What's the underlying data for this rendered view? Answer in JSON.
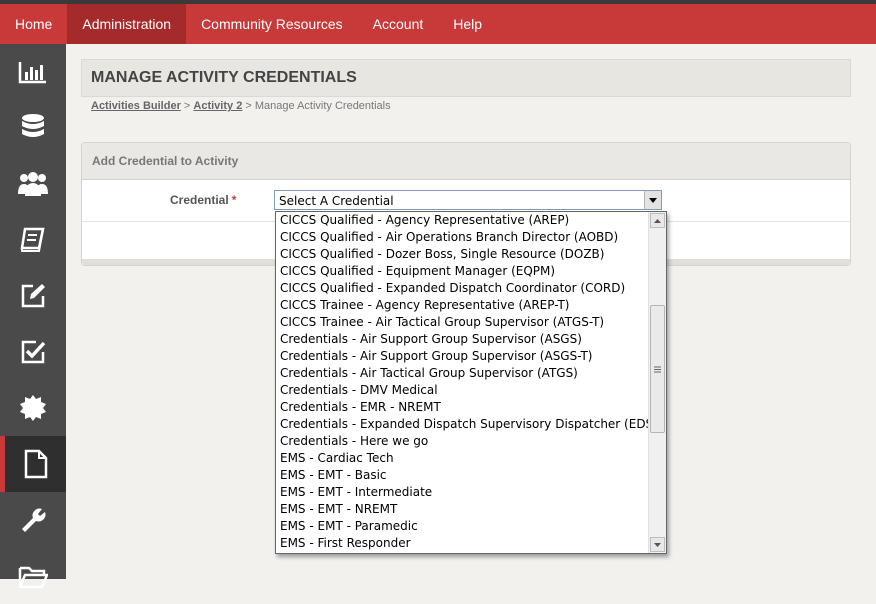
{
  "nav": {
    "items": [
      {
        "label": "Home"
      },
      {
        "label": "Administration"
      },
      {
        "label": "Community Resources"
      },
      {
        "label": "Account"
      },
      {
        "label": "Help"
      }
    ],
    "active": "Administration"
  },
  "sidebar": {
    "icons": [
      "bar-chart-icon",
      "database-icon",
      "users-icon",
      "book-icon",
      "edit-icon",
      "checkbox-icon",
      "certificate-icon",
      "document-icon",
      "wrench-icon",
      "folder-icon"
    ],
    "active": "document-icon"
  },
  "page": {
    "title": "MANAGE ACTIVITY CREDENTIALS"
  },
  "breadcrumb": {
    "link1": "Activities Builder",
    "sep1": " > ",
    "link2": "Activity 2",
    "sep2": " > ",
    "current": "Manage Activity Credentials"
  },
  "panel": {
    "header": "Add Credential to Activity",
    "credential_label": "Credential",
    "required_mark": "*"
  },
  "credential_select": {
    "value": "Select A Credential",
    "options": [
      "CICCS Qualified - Agency Representative (AREP)",
      "CICCS Qualified - Air Operations Branch Director (AOBD)",
      "CICCS Qualified - Dozer Boss, Single Resource (DOZB)",
      "CICCS Qualified - Equipment Manager (EQPM)",
      "CICCS Qualified - Expanded Dispatch Coordinator (CORD)",
      "CICCS Trainee - Agency Representative (AREP-T)",
      "CICCS Trainee - Air Tactical Group Supervisor (ATGS-T)",
      "Credentials - Air Support Group Supervisor (ASGS)",
      "Credentials - Air Support Group Supervisor (ASGS-T)",
      "Credentials - Air Tactical Group Supervisor (ATGS)",
      "Credentials - DMV Medical",
      "Credentials - EMR - NREMT",
      "Credentials - Expanded Dispatch Supervisory Dispatcher (EDSP)",
      "Credentials - Here we go",
      "EMS - Cardiac Tech",
      "EMS - EMT - Basic",
      "EMS - EMT - Intermediate",
      "EMS - EMT - NREMT",
      "EMS - EMT - Paramedic",
      "EMS - First Responder"
    ]
  },
  "colors": {
    "brand_red": "#c8393a",
    "sidebar_bg": "#4a4a4a"
  }
}
